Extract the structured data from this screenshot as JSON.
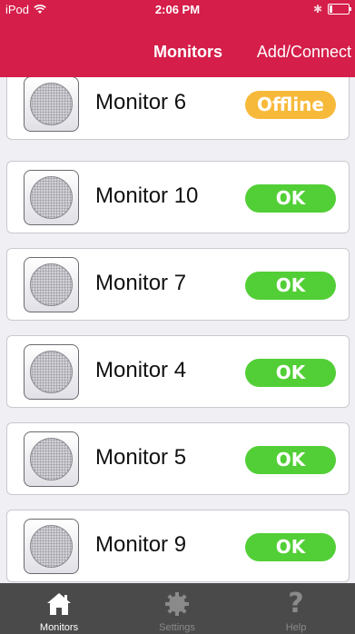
{
  "status_bar": {
    "carrier": "iPod",
    "time": "2:06 PM",
    "bluetooth_icon": "bluetooth-icon",
    "battery_icon": "battery-icon"
  },
  "nav": {
    "title": "Monitors",
    "add_connect": "Add/Connect"
  },
  "monitors": [
    {
      "name": "Monitor 6",
      "status": "Offline",
      "status_type": "offline"
    },
    {
      "name": "Monitor 10",
      "status": "OK",
      "status_type": "ok"
    },
    {
      "name": "Monitor 7",
      "status": "OK",
      "status_type": "ok"
    },
    {
      "name": "Monitor 4",
      "status": "OK",
      "status_type": "ok"
    },
    {
      "name": "Monitor 5",
      "status": "OK",
      "status_type": "ok"
    },
    {
      "name": "Monitor 9",
      "status": "OK",
      "status_type": "ok"
    }
  ],
  "tabbar": {
    "tabs": [
      {
        "label": "Monitors",
        "icon": "home-icon",
        "active": true
      },
      {
        "label": "Settings",
        "icon": "gear-icon",
        "active": false
      },
      {
        "label": "Help",
        "icon": "question-icon",
        "active": false
      }
    ]
  },
  "colors": {
    "header": "#d51e4a",
    "ok": "#52cf36",
    "offline": "#f7b93a",
    "tabbar": "#4a4a4a"
  }
}
